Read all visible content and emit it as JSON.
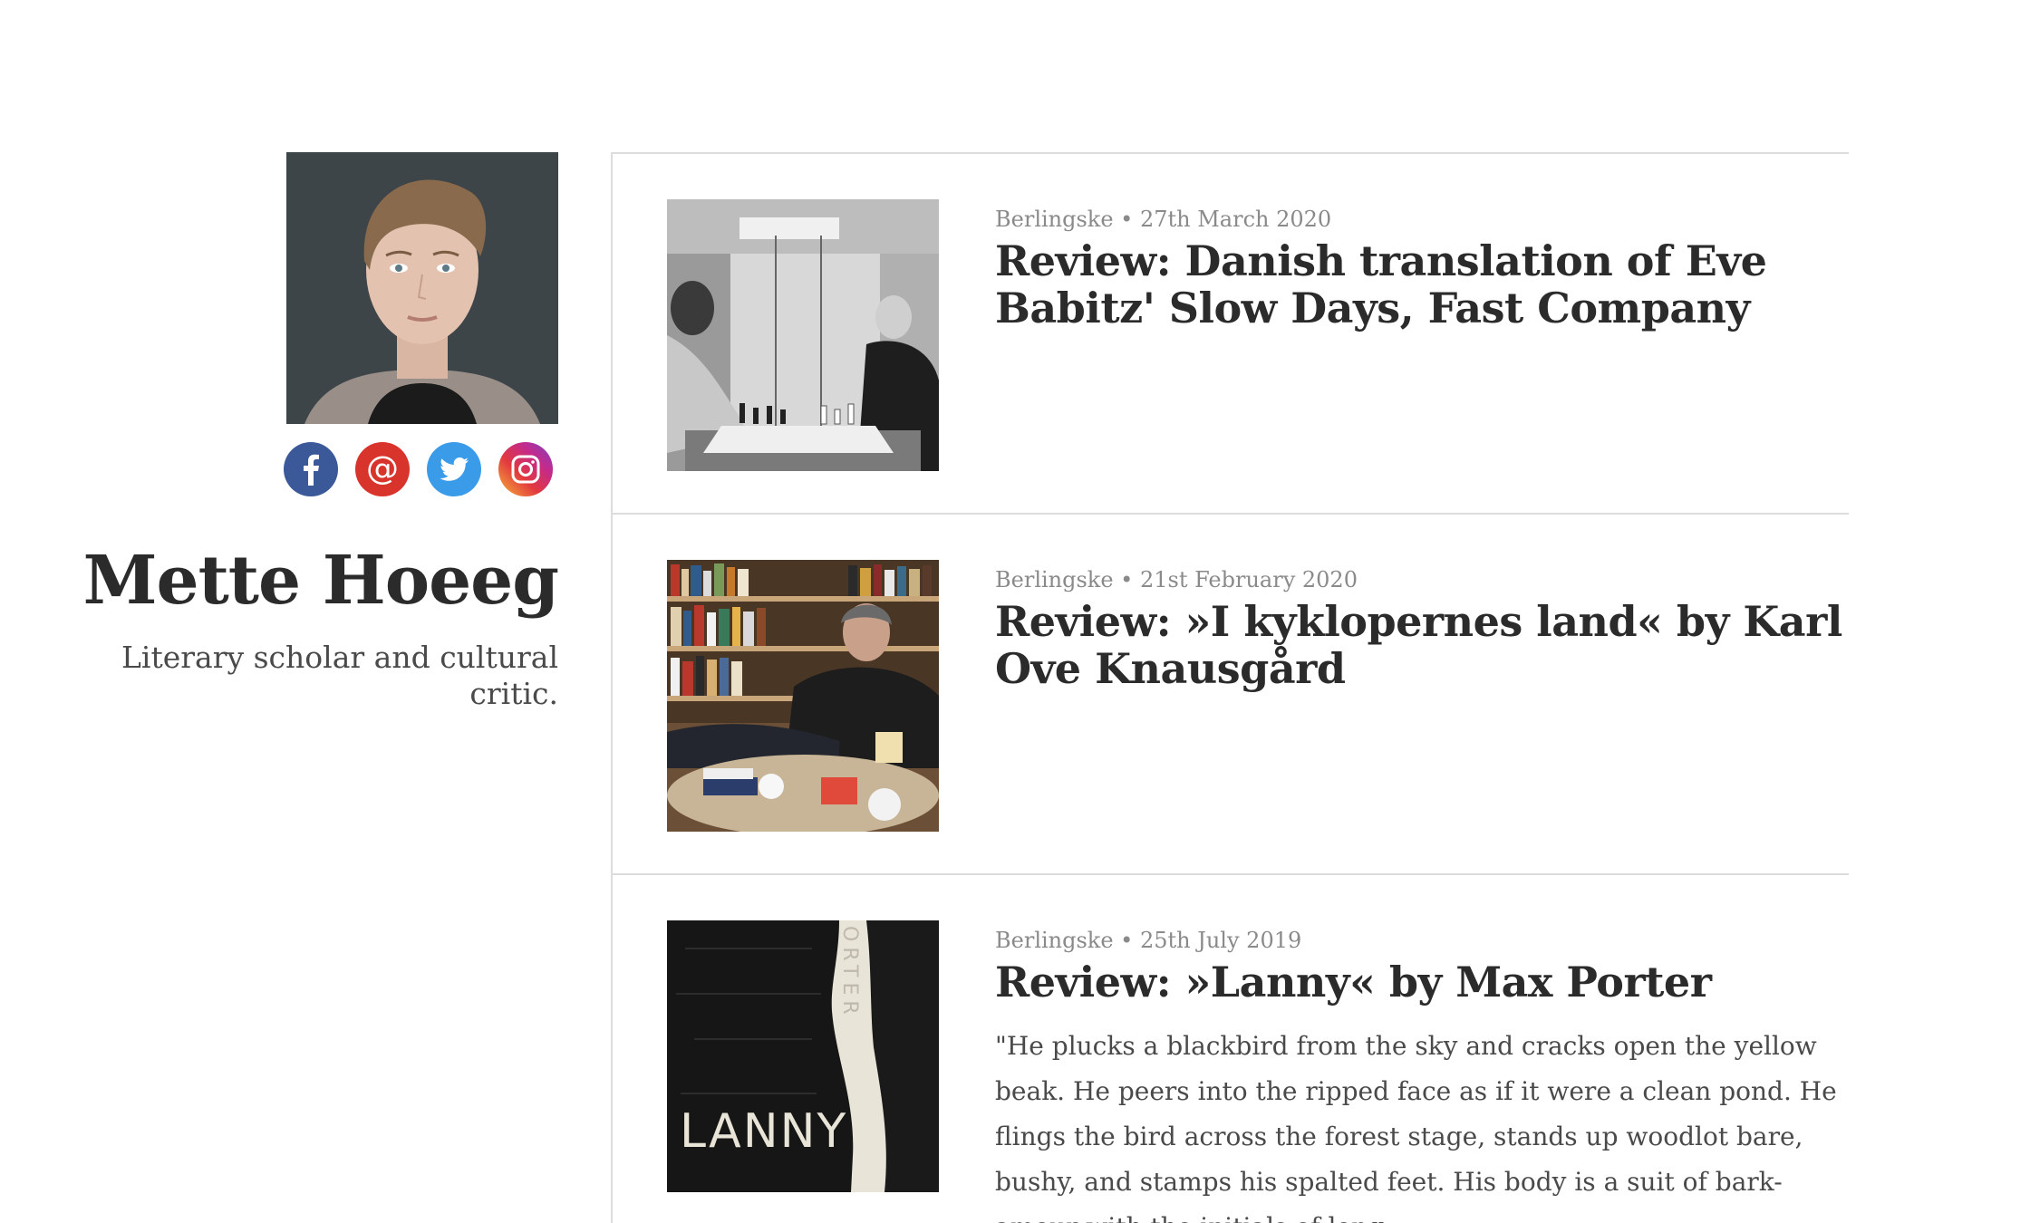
{
  "author": {
    "name": "Mette Hoeeg",
    "tagline": "Literary scholar and cultural critic."
  },
  "social": [
    {
      "name": "facebook",
      "icon": "facebook-icon",
      "glyph": "f",
      "color": "#3b5998"
    },
    {
      "name": "email",
      "icon": "at-sign-icon",
      "glyph": "@",
      "color": "#d9342b"
    },
    {
      "name": "twitter",
      "icon": "twitter-bird-icon",
      "glyph": "",
      "color": "#3a9be9"
    },
    {
      "name": "instagram",
      "icon": "instagram-camera-icon",
      "glyph": "",
      "color": "#c32a8c"
    }
  ],
  "articles": [
    {
      "meta": "Berlingske • 27th March 2020",
      "title": "Review: Danish translation of Eve Babitz' Slow Days, Fast Company",
      "image": "chess-game-photo"
    },
    {
      "meta": "Berlingske • 21st February 2020",
      "title": "Review: »I kyklopernes land« by Karl Ove Knausgård",
      "image": "author-with-bookshelves-photo"
    },
    {
      "meta": "Berlingske • 25th July 2019",
      "title": "Review: »Lanny« by Max Porter",
      "excerpt": "\"He plucks a blackbird from the sky and cracks open the yellow beak. He peers into the ripped face as if it were a clean pond. He flings the bird across the forest stage, stands up woodlot bare, bushy, and stamps his spalted feet. His body is a suit of bark-amour with the initials of long-",
      "image": "lanny-book-cover",
      "cover_title": "LANNY",
      "cover_author_fragment": "ORTER"
    }
  ]
}
